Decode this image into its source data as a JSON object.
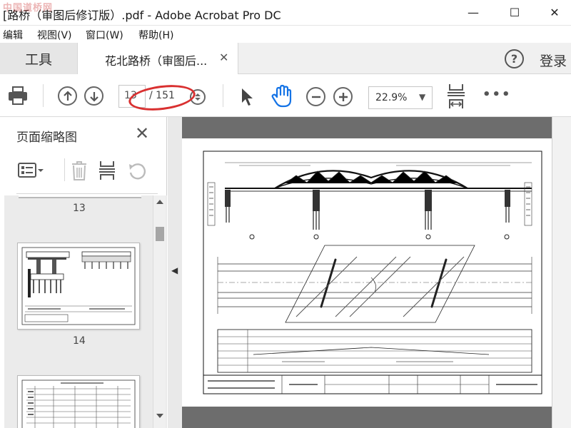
{
  "window": {
    "title": "[路桥（审图后修订版）.pdf - Adobe Acrobat Pro DC",
    "watermark": "中国道桥网",
    "minimize_glyph": "—",
    "maximize_glyph": "☐",
    "close_glyph": "✕"
  },
  "menu": {
    "items": [
      {
        "label": "编辑"
      },
      {
        "label": "视图(V)"
      },
      {
        "label": "窗口(W)"
      },
      {
        "label": "帮助(H)"
      }
    ]
  },
  "tabs": {
    "tools_label": "工具",
    "doc_label": "花北路桥（审图后...",
    "close_glyph": "✕",
    "help_glyph": "?",
    "login_label": "登录"
  },
  "toolbar": {
    "current_page": "13",
    "total_pages": "/ 151",
    "zoom": "22.9%",
    "zoom_caret": "▼",
    "more_glyph": "•••"
  },
  "left_panel": {
    "title": "页面缩略图",
    "close_glyph": "✕",
    "thumbnails": [
      {
        "page_label": "13"
      },
      {
        "page_label": "14"
      }
    ]
  },
  "doc_view": {
    "collapse_glyph": "◀"
  },
  "colors": {
    "annotation": "#d93030",
    "hand_tool": "#1473e6",
    "doc_bg": "#6d6d6d"
  },
  "icons": [
    "print-icon",
    "page-up-icon",
    "page-down-icon",
    "page-stepper-icon",
    "select-arrow-icon",
    "hand-tool-icon",
    "zoom-out-icon",
    "zoom-in-icon",
    "fit-page-icon",
    "more-icon",
    "thumbnail-options-icon",
    "delete-page-icon",
    "insert-page-icon",
    "rotate-page-icon",
    "help-icon"
  ]
}
